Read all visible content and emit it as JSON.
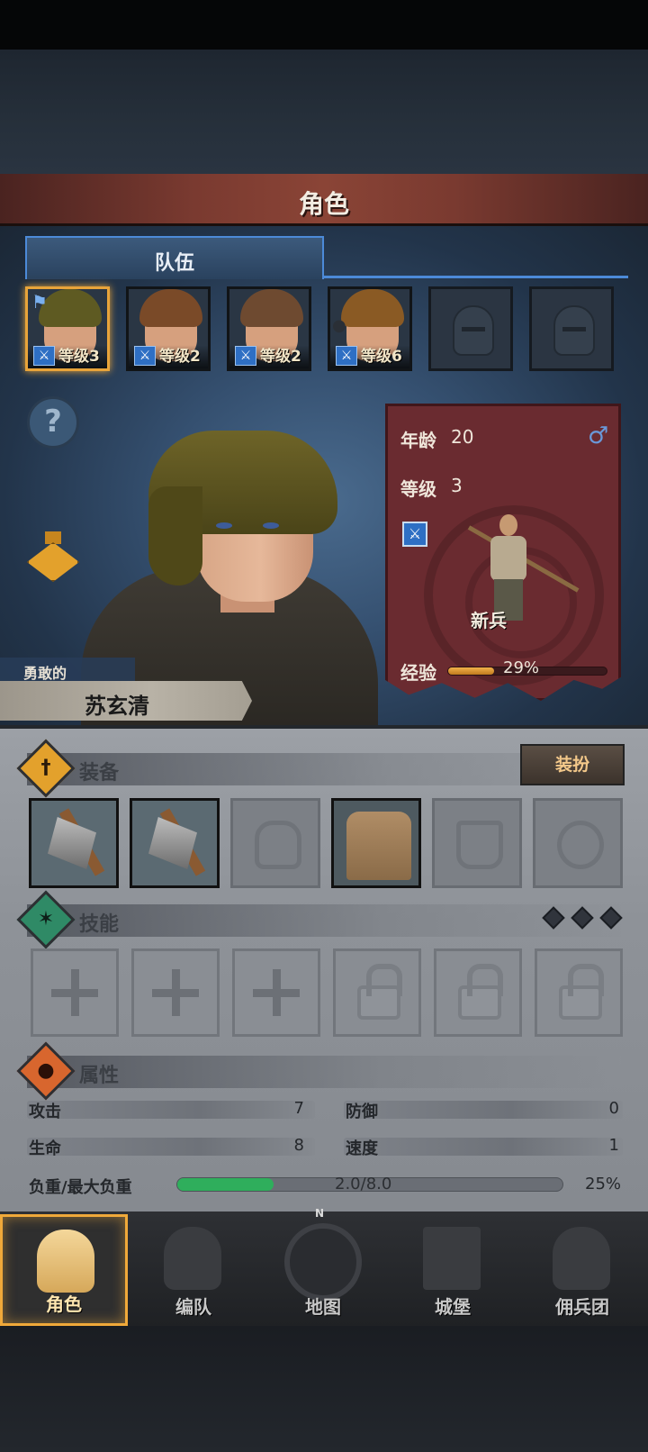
{
  "header": {
    "title": "角色"
  },
  "tabs": [
    {
      "label": "队伍",
      "active": true
    }
  ],
  "party": [
    {
      "level_text": "等级3",
      "selected": true,
      "hair": "#5e5a22",
      "flag": true
    },
    {
      "level_text": "等级2",
      "selected": false,
      "hair": "#7a4a28"
    },
    {
      "level_text": "等级2",
      "selected": false,
      "hair": "#6e4a30"
    },
    {
      "level_text": "等级6",
      "selected": false,
      "hair": "#8a5a24",
      "bag": true
    },
    {
      "empty": true
    },
    {
      "empty": true
    }
  ],
  "hero": {
    "trait": "勇敢的",
    "name": "苏玄清"
  },
  "stats_card": {
    "age_label": "年龄",
    "age": "20",
    "gender_symbol": "♂",
    "level_label": "等级",
    "level": "3",
    "class_name": "新兵",
    "exp_label": "经验",
    "exp_percent_text": "29%",
    "exp_fraction": 0.29
  },
  "equipment": {
    "title": "装备",
    "dress_button": "装扮",
    "slots": [
      "axe",
      "axe",
      "helmet-empty",
      "shirt",
      "boots-empty",
      "ring-empty"
    ]
  },
  "skills": {
    "title": "技能",
    "slots": [
      "empty",
      "empty",
      "empty",
      "locked",
      "locked",
      "locked"
    ]
  },
  "attributes": {
    "title": "属性",
    "attack_label": "攻击",
    "attack": "7",
    "defense_label": "防御",
    "defense": "0",
    "hp_label": "生命",
    "hp": "8",
    "speed_label": "速度",
    "speed": "1",
    "weight_label": "负重/最大负重",
    "weight_text": "2.0/8.0",
    "weight_percent_text": "25%",
    "weight_fraction": 0.25
  },
  "nav": [
    {
      "label": "角色",
      "active": true
    },
    {
      "label": "编队",
      "active": false
    },
    {
      "label": "地图",
      "active": false
    },
    {
      "label": "城堡",
      "active": false
    },
    {
      "label": "佣兵团",
      "active": false
    }
  ],
  "colors": {
    "accent": "#e8a43a",
    "tab_border": "#4c8ad8",
    "card": "#6a2b30",
    "exp": "#e89a30",
    "weight": "#2fae5c"
  }
}
